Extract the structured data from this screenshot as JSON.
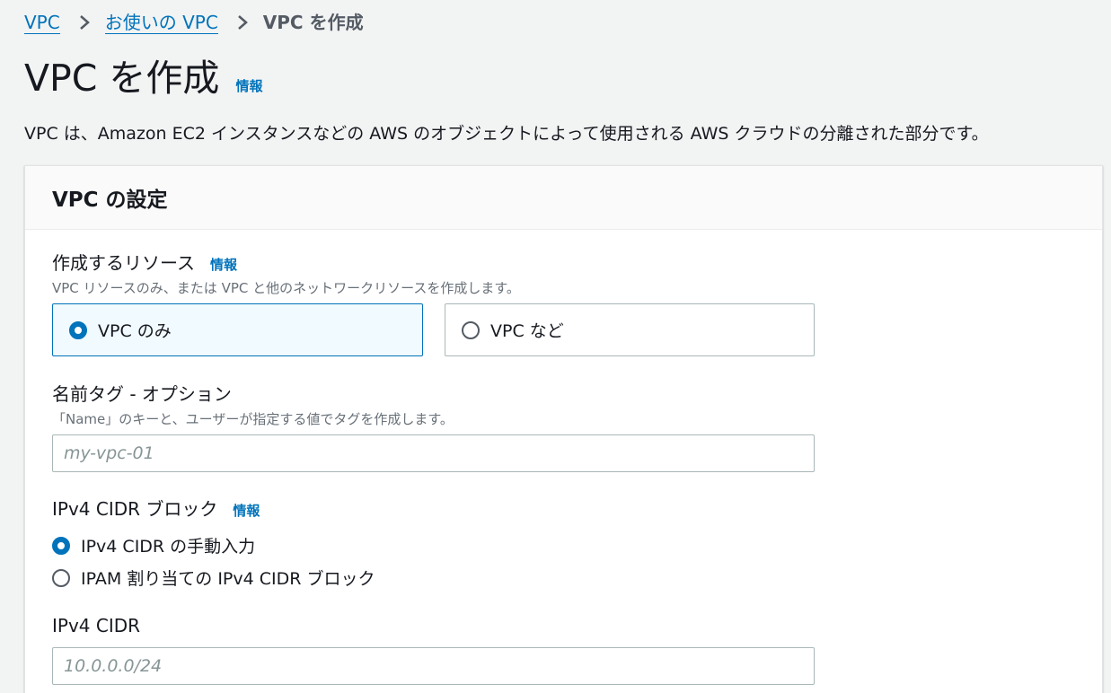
{
  "breadcrumb": {
    "items": [
      "VPC",
      "お使いの VPC"
    ],
    "current": "VPC を作成"
  },
  "page": {
    "title": "VPC を作成",
    "info_label": "情報",
    "description": "VPC は、Amazon EC2 インスタンスなどの AWS のオブジェクトによって使用される AWS クラウドの分離された部分です。"
  },
  "panel": {
    "title": "VPC の設定",
    "resources": {
      "label": "作成するリソース",
      "info_label": "情報",
      "hint": "VPC リソースのみ、または VPC と他のネットワークリソースを作成します。",
      "options": [
        {
          "label": "VPC のみ",
          "selected": true
        },
        {
          "label": "VPC など",
          "selected": false
        }
      ]
    },
    "name_tag": {
      "label": "名前タグ - オプション",
      "hint": "「Name」のキーと、ユーザーが指定する値でタグを作成します。",
      "placeholder": "my-vpc-01",
      "value": ""
    },
    "ipv4_block": {
      "label": "IPv4 CIDR ブロック",
      "info_label": "情報",
      "options": [
        {
          "label": "IPv4 CIDR の手動入力",
          "selected": true
        },
        {
          "label": "IPAM 割り当ての IPv4 CIDR ブロック",
          "selected": false
        }
      ]
    },
    "ipv4_cidr": {
      "label": "IPv4 CIDR",
      "placeholder": "10.0.0.0/24",
      "value": ""
    }
  },
  "colors": {
    "link": "#0073bb",
    "selected_tile_bg": "#f1faff",
    "page_bg": "#f2f3f3"
  }
}
